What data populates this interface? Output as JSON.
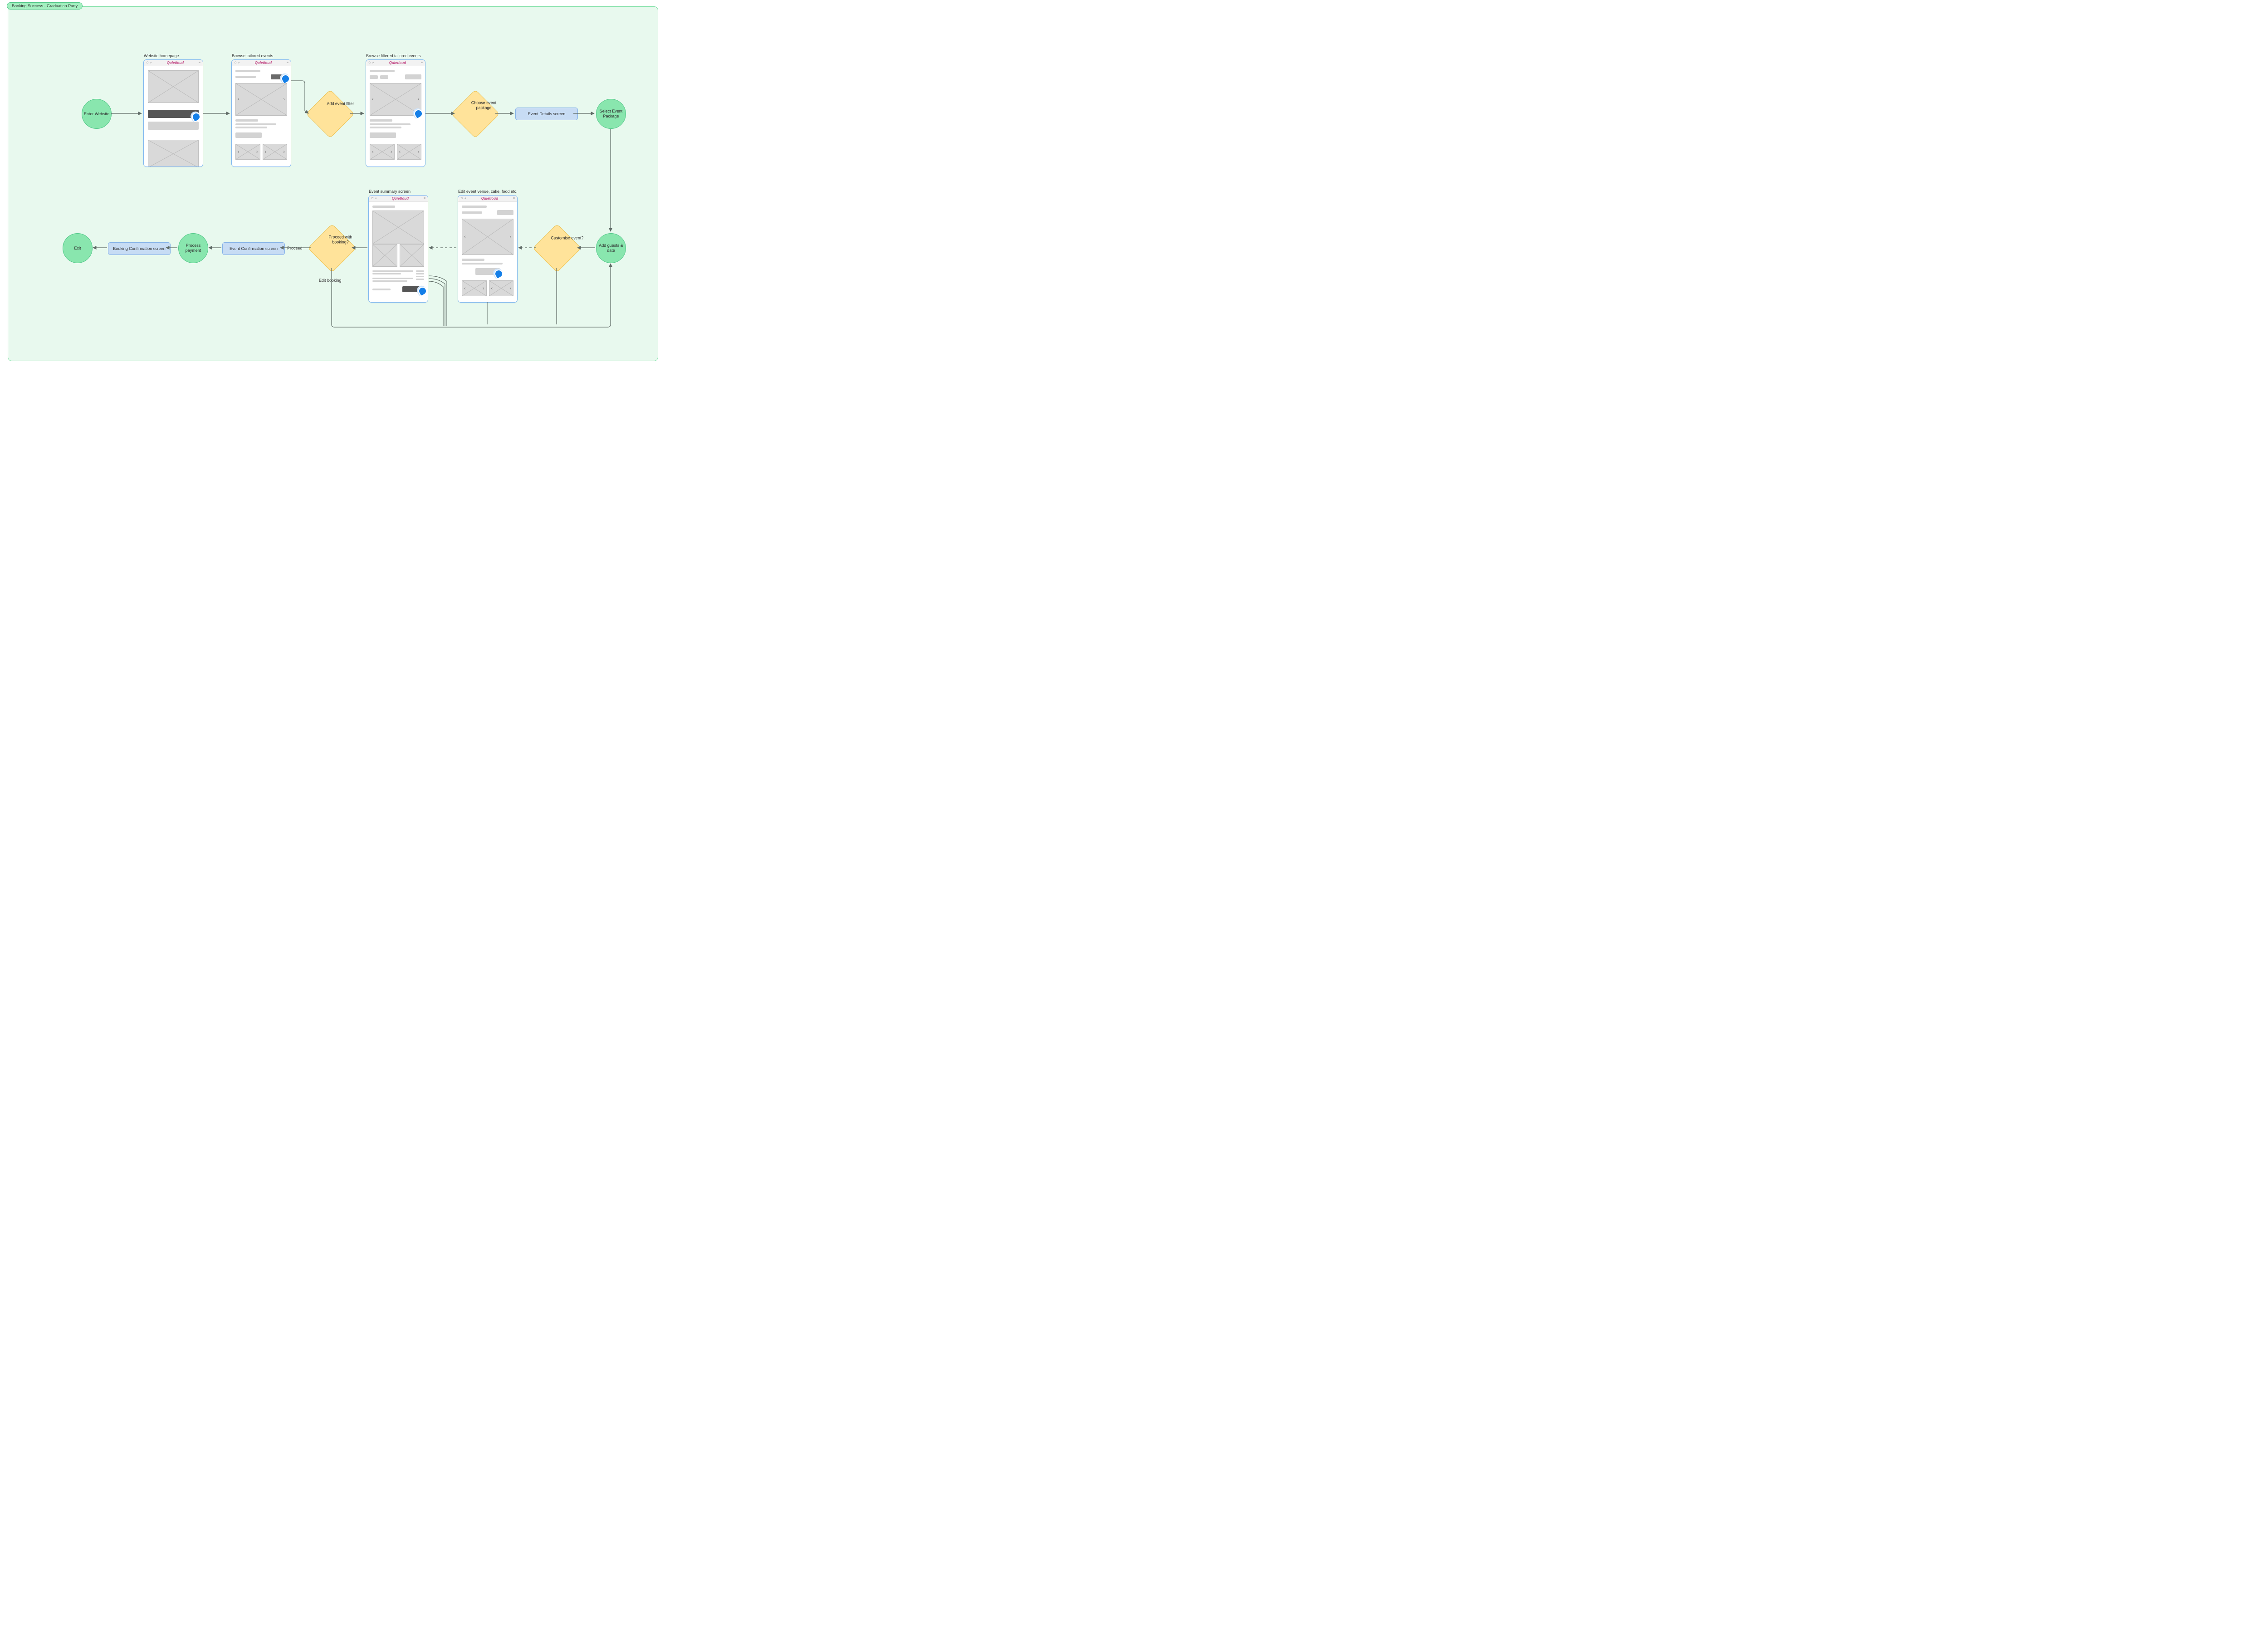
{
  "section": {
    "title": "Booking Success - Graduation Party"
  },
  "brand": "Quietloud",
  "nodes": {
    "enter": "Enter Website",
    "select_pkg": "Select Event Package",
    "add_guests": "Add guests & date",
    "process_pay": "Process payment",
    "exit": "Exit",
    "filter": "Add event filter",
    "choose_pkg": "Choose event package",
    "customise": "Customise event?",
    "proceed_q": "Proceed with booking?",
    "screen_details": "Event Details screen",
    "screen_conf": "Event Confirmation screen",
    "screen_book": "Booking Confirmation screen"
  },
  "phone_labels": {
    "home": "Website homepage",
    "browse": "Browse tailored events",
    "filtered": "Browse filtered tailored events",
    "edit": "Edit event venue, cake, food etc.",
    "summary": "Event summary screen"
  },
  "edge_labels": {
    "proceed": "Proceed",
    "edit": "Edit booking"
  }
}
